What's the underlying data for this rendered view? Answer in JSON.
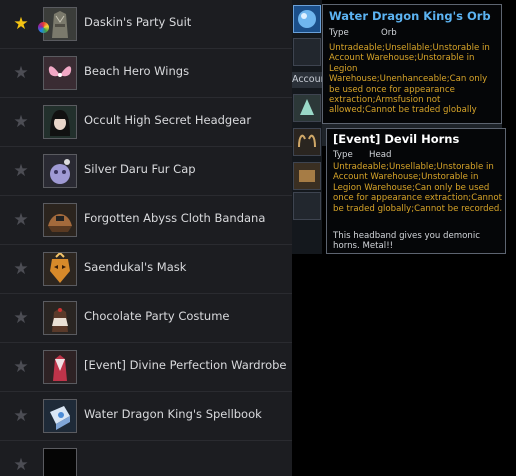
{
  "items": [
    {
      "name": "Daskin's Party Suit",
      "favorite": true,
      "dye": true
    },
    {
      "name": "Beach Hero Wings",
      "favorite": false
    },
    {
      "name": "Occult High Secret Headgear",
      "favorite": false
    },
    {
      "name": "Silver Daru Fur Cap",
      "favorite": false
    },
    {
      "name": "Forgotten Abyss Cloth Bandana",
      "favorite": false
    },
    {
      "name": "Saendukal's Mask",
      "favorite": false
    },
    {
      "name": "Chocolate Party Costume",
      "favorite": false
    },
    {
      "name": "[Event] Divine Perfection Wardrobe",
      "favorite": false
    },
    {
      "name": "Water Dragon King's Spellbook",
      "favorite": false
    },
    {
      "name": "",
      "favorite": false
    }
  ],
  "side": {
    "tab_label": "Account Warehouse"
  },
  "tooltip_orb": {
    "title": "Water Dragon King's Orb",
    "type_label": "Type",
    "type_value": "Orb",
    "restrictions": "Untradeable;Unsellable;Unstorable in Account Warehouse;Unstorable in Legion Warehouse;Unenhanceable;Can only be used once for appearance extraction;Armsfusion not allowed;Cannot be traded globally"
  },
  "tooltip_horns": {
    "title": "[Event] Devil Horns",
    "type_label": "Type",
    "type_value": "Head",
    "restrictions": "Untradeable;Unsellable;Unstorable in Account Warehouse;Unstorable in Legion Warehouse;Can only be used once for appearance extraction;Cannot be traded globally;Cannot be recorded.",
    "description": "This headband gives you demonic horns. Metal!!"
  },
  "colors": {
    "title_blue": "#5cb3f2",
    "title_white": "#ffffff",
    "restriction_gold": "#d7a429",
    "favorite_gold": "#f4c313"
  },
  "icons": [
    "star-icon",
    "color-dye-icon",
    "item-thumbnail",
    "orb-icon",
    "horns-icon"
  ]
}
